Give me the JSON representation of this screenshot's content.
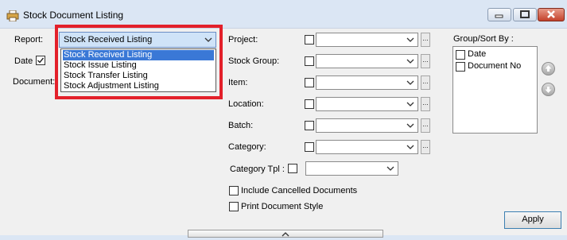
{
  "window": {
    "title": "Stock Document Listing",
    "icon": "printer-icon"
  },
  "form": {
    "report_label": "Report:",
    "report_value": "Stock Received Listing",
    "report_options": [
      "Stock Received Listing",
      "Stock Issue Listing",
      "Stock Transfer Listing",
      "Stock Adjustment Listing"
    ],
    "date_label": "Date",
    "date_checked": true,
    "document_label": "Document:"
  },
  "filters": [
    {
      "label": "Project:",
      "value": ""
    },
    {
      "label": "Stock Group:",
      "value": ""
    },
    {
      "label": "Item:",
      "value": ""
    },
    {
      "label": "Location:",
      "value": ""
    },
    {
      "label": "Batch:",
      "value": ""
    },
    {
      "label": "Category:",
      "value": ""
    }
  ],
  "category_tpl": {
    "label": "Category Tpl :",
    "value": ""
  },
  "options": {
    "include_cancelled": "Include Cancelled Documents",
    "print_style": "Print Document Style"
  },
  "group_sort": {
    "label": "Group/Sort By :",
    "items": [
      "Date",
      "Document No"
    ]
  },
  "buttons": {
    "apply": "Apply",
    "more_label": "..."
  },
  "colors": {
    "highlight": "#e3202a",
    "selection": "#3a78d6"
  }
}
